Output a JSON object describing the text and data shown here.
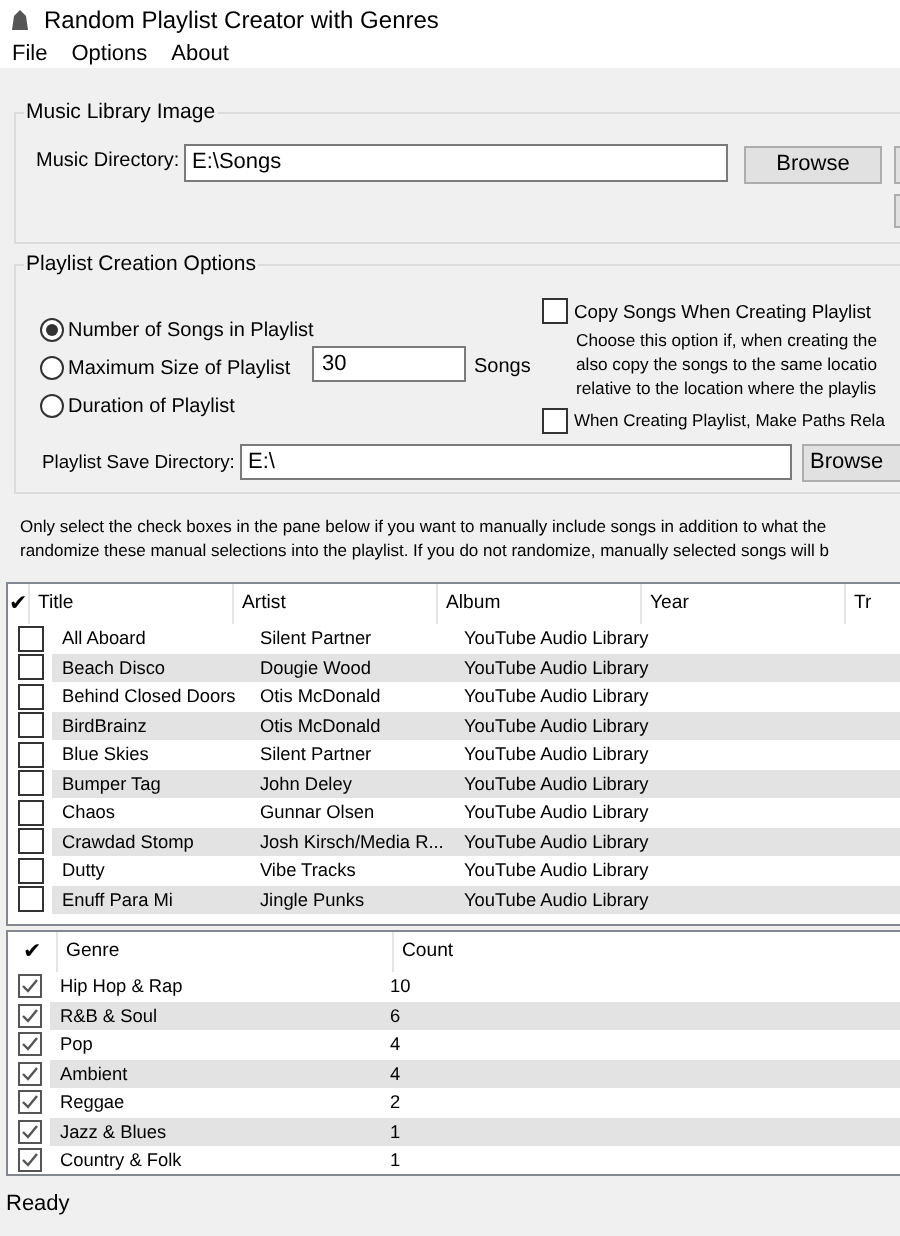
{
  "window": {
    "title": "Random Playlist Creator with Genres"
  },
  "menu": [
    "File",
    "Options",
    "About"
  ],
  "music_library": {
    "title": "Music Library Image",
    "directory_label": "Music Directory:",
    "directory_value": "E:\\Songs",
    "browse_button": "Browse"
  },
  "playlist_options": {
    "title": "Playlist Creation Options",
    "modes": [
      {
        "label": "Number of Songs in Playlist",
        "selected": true
      },
      {
        "label": "Maximum Size of Playlist",
        "selected": false
      },
      {
        "label": "Duration of Playlist",
        "selected": false
      }
    ],
    "size_value": "30",
    "size_unit": "Songs",
    "copy_songs": {
      "label": "Copy Songs When Creating Playlist",
      "checked": false
    },
    "copy_description": [
      "Choose this option if, when creating the",
      "also copy the songs to the same locatio",
      "relative to the location where the playlis"
    ],
    "relative_paths": {
      "label": "When Creating Playlist, Make Paths Rela",
      "checked": false
    },
    "save_dir_label": "Playlist Save Directory:",
    "save_dir_value": "E:\\",
    "browse_button": "Browse"
  },
  "instructions": [
    "Only select the check boxes in the pane below if you want to manually include songs in addition to what the",
    "randomize these manual selections into the playlist.  If you do not randomize, manually selected songs will b"
  ],
  "songs_table": {
    "check_header": "✔",
    "columns": [
      "Title",
      "Artist",
      "Album",
      "Year",
      "Tr"
    ],
    "rows": [
      {
        "checked": false,
        "cells": [
          "All Aboard",
          "Silent Partner",
          "YouTube Audio Library"
        ]
      },
      {
        "checked": false,
        "cells": [
          "Beach Disco",
          "Dougie Wood",
          "YouTube Audio Library"
        ]
      },
      {
        "checked": false,
        "cells": [
          "Behind Closed Doors",
          "Otis McDonald",
          "YouTube Audio Library"
        ]
      },
      {
        "checked": false,
        "cells": [
          "BirdBrainz",
          "Otis McDonald",
          "YouTube Audio Library"
        ]
      },
      {
        "checked": false,
        "cells": [
          "Blue Skies",
          "Silent Partner",
          "YouTube Audio Library"
        ]
      },
      {
        "checked": false,
        "cells": [
          "Bumper Tag",
          "John Deley",
          "YouTube Audio Library"
        ]
      },
      {
        "checked": false,
        "cells": [
          "Chaos",
          "Gunnar Olsen",
          "YouTube Audio Library"
        ]
      },
      {
        "checked": false,
        "cells": [
          "Crawdad Stomp",
          "Josh Kirsch/Media R...",
          "YouTube Audio Library"
        ]
      },
      {
        "checked": false,
        "cells": [
          "Dutty",
          "Vibe Tracks",
          "YouTube Audio Library"
        ]
      },
      {
        "checked": false,
        "cells": [
          "Enuff Para Mi",
          "Jingle Punks",
          "YouTube Audio Library"
        ]
      }
    ]
  },
  "genres_table": {
    "check_header": "✔",
    "columns": [
      "Genre",
      "Count"
    ],
    "rows": [
      {
        "checked": true,
        "cells": [
          "Hip Hop & Rap",
          "10"
        ]
      },
      {
        "checked": true,
        "cells": [
          "R&B & Soul",
          "6"
        ]
      },
      {
        "checked": true,
        "cells": [
          "Pop",
          "4"
        ]
      },
      {
        "checked": true,
        "cells": [
          "Ambient",
          "4"
        ]
      },
      {
        "checked": true,
        "cells": [
          "Reggae",
          "2"
        ]
      },
      {
        "checked": true,
        "cells": [
          "Jazz & Blues",
          "1"
        ]
      },
      {
        "checked": true,
        "cells": [
          "Country & Folk",
          "1"
        ]
      }
    ]
  },
  "status_bar": "Ready"
}
